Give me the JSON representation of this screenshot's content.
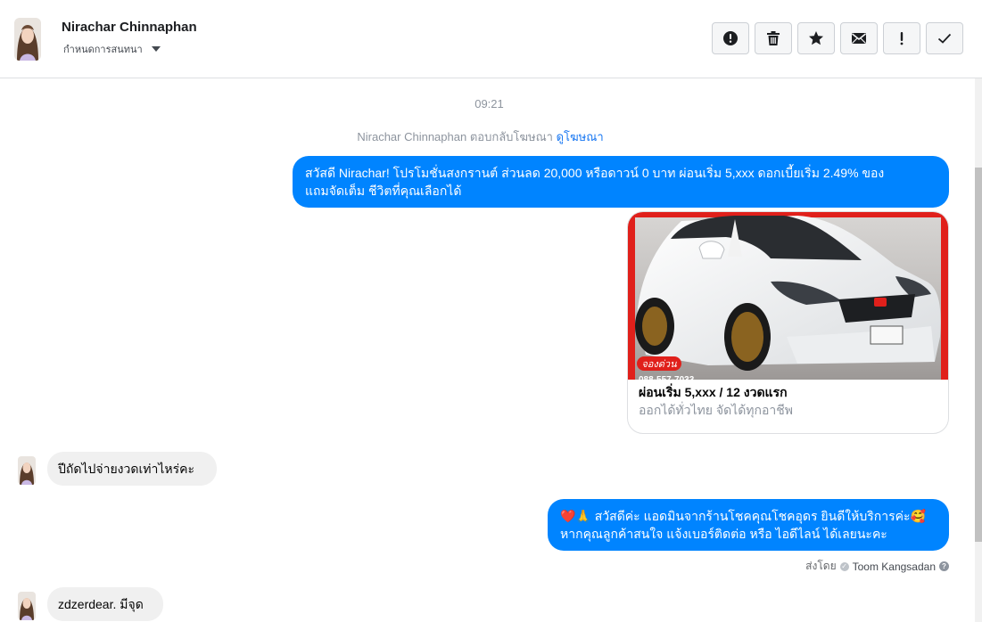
{
  "header": {
    "name": "Nirachar Chinnaphan",
    "subtitle": "กำหนดการสนทนา",
    "toolbar": [
      {
        "icon": "alert-circle-icon"
      },
      {
        "icon": "trash-icon"
      },
      {
        "icon": "star-icon"
      },
      {
        "icon": "envelope-icon"
      },
      {
        "icon": "exclamation-icon"
      },
      {
        "icon": "check-icon"
      }
    ]
  },
  "conversation": {
    "timestamp": "09:21",
    "system": {
      "text": "Nirachar Chinnaphan ตอบกลับโฆษณา",
      "link": "ดูโฆษณา"
    },
    "messages": [
      {
        "direction": "outgoing",
        "line1": "สวัสดี Nirachar! โปรโมชั่นสงกรานต์ ส่วนลด 20,000 หรือดาวน์ 0 บาท ผ่อนเริ่ม 5,xxx ดอกเบี้ยเริ่ม 2.49% ของ",
        "line2": "แถมจัดเต็ม ชีวิตที่คุณเลือกได้"
      },
      {
        "direction": "outgoing",
        "type": "ad-card",
        "image_badge": "จองด่วน",
        "image_phone": "088-557-7033",
        "title": "ผ่อนเริ่ม 5,xxx / 12 งวดแรก",
        "subtitle": "ออกได้ทั่วไทย จัดได้ทุกอาชีพ"
      },
      {
        "direction": "incoming",
        "text": "ปีถัดไปจ่ายงวดเท่าไหร่คะ"
      },
      {
        "direction": "outgoing",
        "line1": "❤️🙏 สวัสดีค่ะ แอดมินจากร้านโชคคุณโชคอุดร ยินดีให้บริการค่ะ🥰",
        "line2": "หากคุณลูกค้าสนใจ แจ้งเบอร์ติดต่อ หรือ ไอดีไลน์ ได้เลยนะคะ"
      },
      {
        "direction": "incoming",
        "text": "zdzerdear. มีจุด"
      }
    ],
    "sent_by": {
      "label": "ส่งโดย",
      "name": "Toom Kangsadan"
    }
  },
  "colors": {
    "outgoing_bubble": "#0084ff",
    "incoming_bubble": "#f0f0f0",
    "link": "#1877f2",
    "ad_frame": "#e0201b"
  }
}
